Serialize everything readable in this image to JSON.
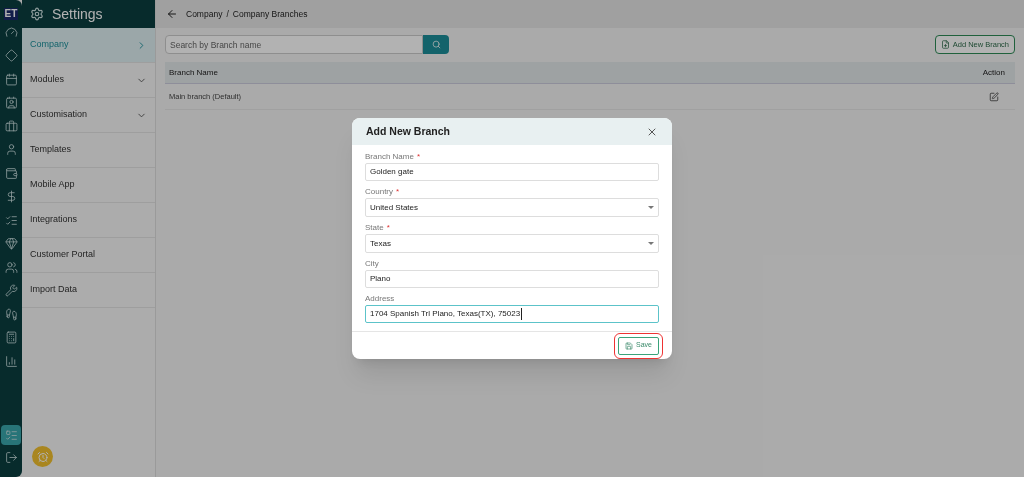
{
  "rail": {
    "logo": "ET",
    "items": [
      {
        "selected": false
      },
      {
        "selected": false
      },
      {
        "selected": false
      },
      {
        "selected": false
      },
      {
        "selected": false
      },
      {
        "selected": false
      },
      {
        "selected": false
      },
      {
        "selected": false
      },
      {
        "selected": false
      },
      {
        "selected": false
      },
      {
        "selected": false
      },
      {
        "selected": false
      },
      {
        "selected": false
      },
      {
        "selected": false
      },
      {
        "selected": false
      },
      {
        "selected": true
      },
      {
        "selected": false
      }
    ]
  },
  "sidebar": {
    "title": "Settings",
    "items": [
      {
        "label": "Company",
        "selected": true,
        "kind": "link"
      },
      {
        "label": "Modules",
        "selected": false,
        "kind": "group"
      },
      {
        "label": "Customisation",
        "selected": false,
        "kind": "group"
      },
      {
        "label": "Templates",
        "selected": false,
        "kind": "plain"
      },
      {
        "label": "Mobile App",
        "selected": false,
        "kind": "plain"
      },
      {
        "label": "Integrations",
        "selected": false,
        "kind": "plain"
      },
      {
        "label": "Customer Portal",
        "selected": false,
        "kind": "plain"
      },
      {
        "label": "Import Data",
        "selected": false,
        "kind": "plain"
      }
    ]
  },
  "breadcrumb": [
    "Company",
    "/",
    "Company Branches"
  ],
  "search": {
    "placeholder": "Search by Branch name"
  },
  "add_button": "Add New Branch",
  "table": {
    "columns": [
      "Branch Name",
      "Action"
    ],
    "rows": [
      {
        "name": "Main branch (Default)"
      }
    ]
  },
  "dialog": {
    "title": "Add New Branch",
    "fields": [
      {
        "label": "Branch Name",
        "required_mark": "*",
        "kind": "text",
        "value": "Golden gate",
        "focused": false
      },
      {
        "label": "Country",
        "required_mark": "*",
        "kind": "select",
        "value": "United States",
        "focused": false
      },
      {
        "label": "State",
        "required_mark": "*",
        "kind": "select",
        "value": "Texas",
        "focused": false
      },
      {
        "label": "City",
        "kind": "text",
        "value": "Plano",
        "focused": false
      },
      {
        "label": "Address",
        "kind": "text",
        "value": "1704 Spanish Trl Plano, Texas(TX), 75023",
        "focused": true
      }
    ],
    "save": "Save"
  }
}
